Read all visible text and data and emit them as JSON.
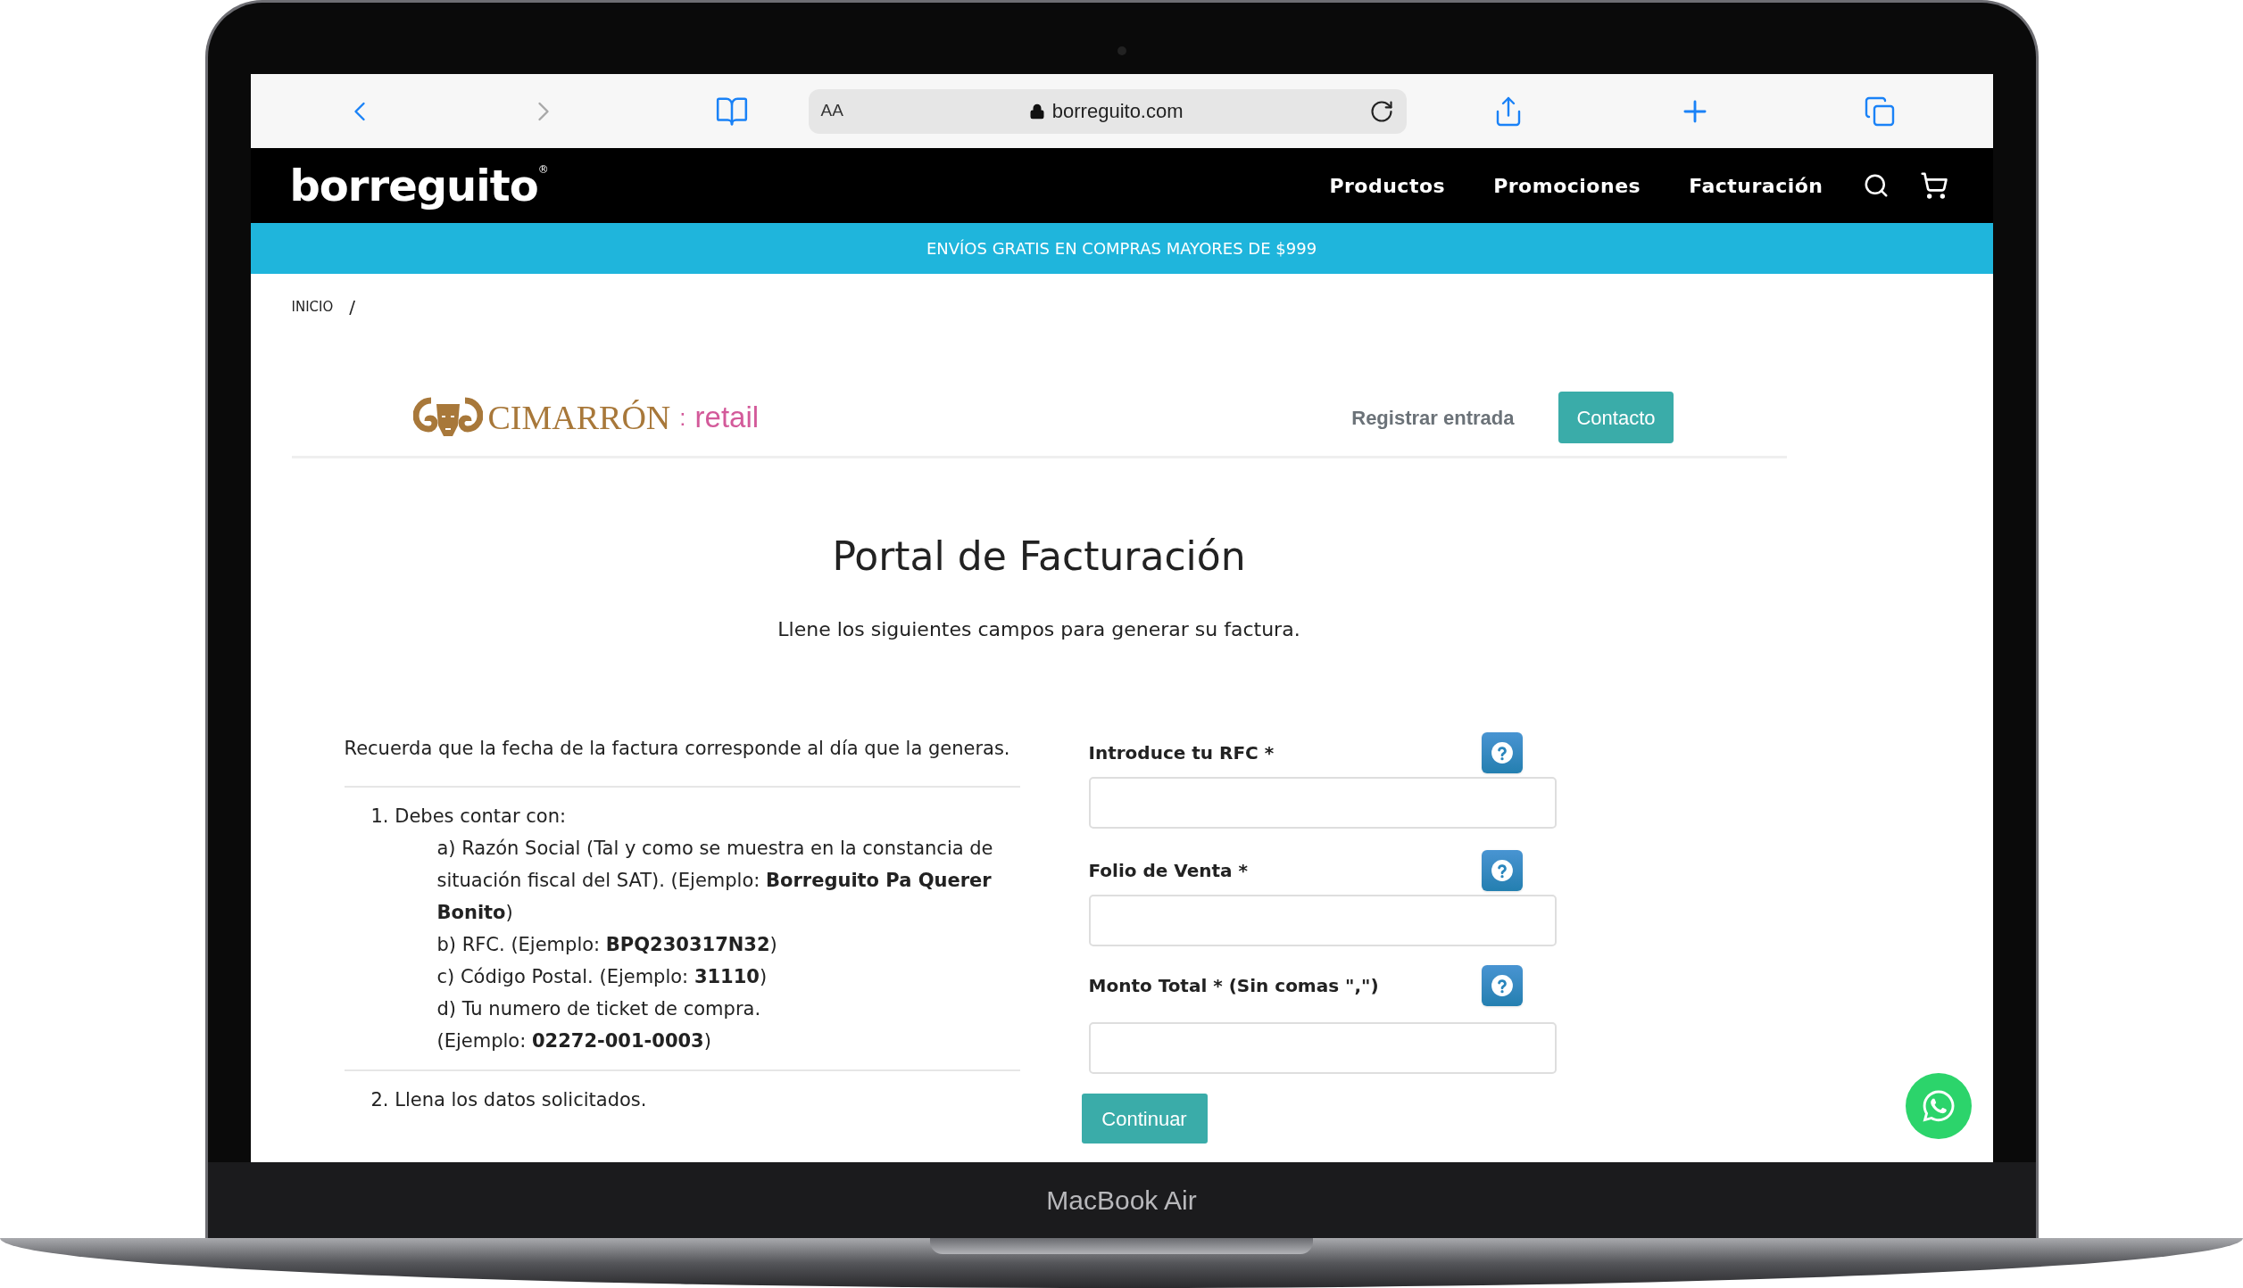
{
  "browser": {
    "text_size_button": "AA",
    "url": "borreguito.com"
  },
  "site_header": {
    "logo": "borreguito",
    "logo_mark": "®",
    "nav": [
      "Productos",
      "Promociones",
      "Facturación"
    ]
  },
  "banner": "ENVÍOS GRATIS EN COMPRAS MAYORES DE $999",
  "breadcrumb": {
    "items": [
      "INICIO"
    ],
    "separator": "/"
  },
  "portal_header": {
    "brand": "CIMARRÓN",
    "brand_separator": ":",
    "brand_suffix": "retail",
    "login": "Registrar entrada",
    "contact": "Contacto"
  },
  "title": "Portal de Facturación",
  "subtitle": "Llene los siguientes campos para generar su factura.",
  "instructions": {
    "note": "Recuerda que la fecha de la factura corresponde al día que la generas.",
    "steps": [
      {
        "text": "1. Debes contar con:",
        "items": [
          "a) Razón Social (Tal y como se muestra en la constancia de situación fiscal del SAT). (Ejemplo: **Borreguito Pa Querer Bonito**)",
          "b) RFC. (Ejemplo: **BPQ230317N32**)",
          "c) Código Postal. (Ejemplo: **31110**)",
          "d) Tu numero de ticket de compra.",
          "(Ejemplo: **02272-001-0003**)"
        ]
      },
      {
        "text": "2. Llena los datos solicitados."
      }
    ]
  },
  "form": {
    "fields": [
      {
        "label": "Introduce tu RFC *"
      },
      {
        "label": "Folio de Venta *"
      },
      {
        "label": "Monto Total * (Sin comas \",\")"
      }
    ],
    "submit": "Continuar"
  },
  "device": {
    "label": "MacBook Air"
  }
}
